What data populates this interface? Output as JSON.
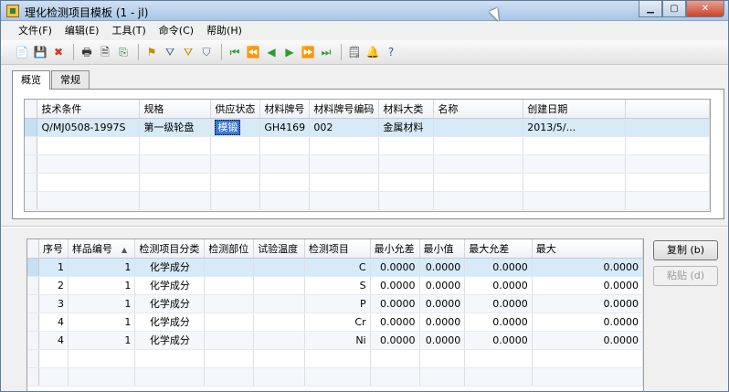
{
  "window": {
    "title": "理化检测项目模板 (1 - jl)"
  },
  "window_controls": {
    "minimize": "▁",
    "maximize": "▢",
    "close": "✕"
  },
  "menu": [
    {
      "label": "文件(F)"
    },
    {
      "label": "编辑(E)"
    },
    {
      "label": "工具(T)"
    },
    {
      "label": "命令(C)"
    },
    {
      "label": "帮助(H)"
    }
  ],
  "toolbar": {
    "icons": [
      {
        "name": "new-icon",
        "glyph": "📄",
        "color": "#ffffff"
      },
      {
        "name": "save-icon",
        "glyph": "💾",
        "color": "#333333"
      },
      {
        "name": "delete-icon",
        "glyph": "✖",
        "color": "#d9362b"
      },
      {
        "name": "print-icon",
        "glyph": "🖶",
        "color": "#333333"
      },
      {
        "name": "print-preview-icon",
        "glyph": "🗎",
        "color": "#333333"
      },
      {
        "name": "export-icon",
        "glyph": "⎘",
        "color": "#2b8a3e"
      },
      {
        "name": "filter-add-icon",
        "glyph": "⚑",
        "color": "#c78b00"
      },
      {
        "name": "filter-edit-icon",
        "glyph": "⛛",
        "color": "#4b6a8c"
      },
      {
        "name": "filter-apply-icon",
        "glyph": "⛛",
        "color": "#c78b00"
      },
      {
        "name": "filter-clear-icon",
        "glyph": "⛉",
        "color": "#4b6a8c"
      },
      {
        "name": "first-record-icon",
        "glyph": "⏮",
        "color": "#2e9a2e"
      },
      {
        "name": "prev-page-icon",
        "glyph": "⏪",
        "color": "#2e9a2e"
      },
      {
        "name": "prev-record-icon",
        "glyph": "◀",
        "color": "#2e9a2e"
      },
      {
        "name": "next-record-icon",
        "glyph": "▶",
        "color": "#2e9a2e"
      },
      {
        "name": "next-page-icon",
        "glyph": "⏩",
        "color": "#2e9a2e"
      },
      {
        "name": "last-record-icon",
        "glyph": "⏭",
        "color": "#2e9a2e"
      },
      {
        "name": "notes-icon",
        "glyph": "🗒",
        "color": "#555555"
      },
      {
        "name": "alert-icon",
        "glyph": "🔔",
        "color": "#d4a017"
      },
      {
        "name": "help-icon",
        "glyph": "?",
        "color": "#1e5bbd"
      }
    ]
  },
  "tabs": [
    {
      "label": "概览",
      "active": true
    },
    {
      "label": "常规",
      "active": false
    }
  ],
  "upper_grid": {
    "columns": [
      "技术条件",
      "规格",
      "供应状态",
      "材料牌号",
      "材料牌号编码",
      "材料大类",
      "名称",
      "创建日期"
    ],
    "rows": [
      [
        "Q/MJ0508-1997S",
        "第一级轮盘",
        "模锻",
        "GH4169",
        "002",
        "金属材料",
        "",
        "2013/5/..."
      ]
    ]
  },
  "lower_grid": {
    "columns": [
      "序号",
      "样品编号",
      "检测项目分类",
      "检测部位",
      "试验温度",
      "检测项目",
      "最小允差",
      "最小值",
      "最大允差",
      "最大"
    ],
    "sort_indicator": "▲",
    "rows": [
      [
        "1",
        "1",
        "化学成分",
        "",
        "",
        "C",
        "0.0000",
        "0.0000",
        "0.0000",
        "0.0000"
      ],
      [
        "2",
        "1",
        "化学成分",
        "",
        "",
        "S",
        "0.0000",
        "0.0000",
        "0.0000",
        "0.0000"
      ],
      [
        "3",
        "1",
        "化学成分",
        "",
        "",
        "P",
        "0.0000",
        "0.0000",
        "0.0000",
        "0.0000"
      ],
      [
        "4",
        "1",
        "化学成分",
        "",
        "",
        "Cr",
        "0.0000",
        "0.0000",
        "0.0000",
        "0.0000"
      ],
      [
        "4",
        "1",
        "化学成分",
        "",
        "",
        "Ni",
        "0.0000",
        "0.0000",
        "0.0000",
        "0.0000"
      ]
    ]
  },
  "buttons": {
    "copy": "复制 (b)",
    "paste": "粘贴 (d)"
  }
}
